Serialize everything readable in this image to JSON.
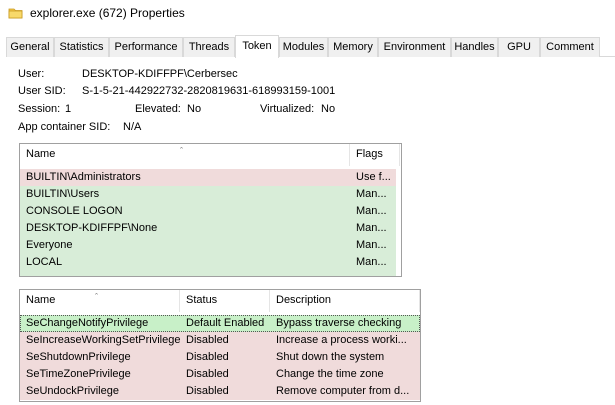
{
  "window": {
    "title": "explorer.exe (672) Properties"
  },
  "tabs": [
    {
      "label": "General"
    },
    {
      "label": "Statistics"
    },
    {
      "label": "Performance"
    },
    {
      "label": "Threads"
    },
    {
      "label": "Token"
    },
    {
      "label": "Modules"
    },
    {
      "label": "Memory"
    },
    {
      "label": "Environment"
    },
    {
      "label": "Handles"
    },
    {
      "label": "GPU"
    },
    {
      "label": "Comment"
    }
  ],
  "active_tab": "Token",
  "token": {
    "user_label": "User:",
    "user_value": "DESKTOP-KDIFFPF\\Cerbersec",
    "sid_label": "User SID:",
    "sid_value": "S-1-5-21-442922732-2820819631-618993159-1001",
    "session_label": "Session:",
    "session_value": "1",
    "elevated_label": "Elevated:",
    "elevated_value": "No",
    "virtualized_label": "Virtualized:",
    "virtualized_value": "No",
    "appcontainer_label": "App container SID:",
    "appcontainer_value": "N/A"
  },
  "groups": {
    "columns": [
      "Name",
      "Flags"
    ],
    "rows": [
      {
        "name": "BUILTIN\\Administrators",
        "flags": "Use f...",
        "state": "denied"
      },
      {
        "name": "BUILTIN\\Users",
        "flags": "Man...",
        "state": "enabled"
      },
      {
        "name": "CONSOLE LOGON",
        "flags": "Man...",
        "state": "enabled"
      },
      {
        "name": "DESKTOP-KDIFFPF\\None",
        "flags": "Man...",
        "state": "enabled"
      },
      {
        "name": "Everyone",
        "flags": "Man...",
        "state": "enabled"
      },
      {
        "name": "LOCAL",
        "flags": "Man...",
        "state": "enabled"
      }
    ]
  },
  "privileges": {
    "columns": [
      "Name",
      "Status",
      "Description"
    ],
    "rows": [
      {
        "name": "SeChangeNotifyPrivilege",
        "status": "Default Enabled",
        "description": "Bypass traverse checking",
        "state": "enabled"
      },
      {
        "name": "SeIncreaseWorkingSetPrivilege",
        "status": "Disabled",
        "description": "Increase a process worki...",
        "state": "disabled"
      },
      {
        "name": "SeShutdownPrivilege",
        "status": "Disabled",
        "description": "Shut down the system",
        "state": "disabled"
      },
      {
        "name": "SeTimeZonePrivilege",
        "status": "Disabled",
        "description": "Change the time zone",
        "state": "disabled"
      },
      {
        "name": "SeUndockPrivilege",
        "status": "Disabled",
        "description": "Remove computer from d...",
        "state": "disabled"
      }
    ]
  },
  "colors": {
    "enabled": "#d8edd8",
    "denied": "#f0dbdb",
    "default_enabled": "#c8f0c8"
  }
}
